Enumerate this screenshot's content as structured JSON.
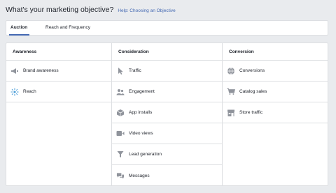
{
  "header": {
    "title": "What's your marketing objective?",
    "help_link": "Help: Choosing an Objective"
  },
  "tabs": [
    {
      "label": "Auction",
      "active": true
    },
    {
      "label": "Reach and Frequency",
      "active": false
    }
  ],
  "colors": {
    "accent": "#4267b2",
    "icon": "#90949c",
    "border": "#dddfe2",
    "background": "#e9ebee"
  },
  "columns": [
    {
      "title": "Awareness",
      "items": [
        {
          "label": "Brand awareness",
          "icon": "megaphone-icon"
        },
        {
          "label": "Reach",
          "icon": "reach-icon"
        }
      ]
    },
    {
      "title": "Consideration",
      "items": [
        {
          "label": "Traffic",
          "icon": "cursor-icon"
        },
        {
          "label": "Engagement",
          "icon": "people-icon"
        },
        {
          "label": "App installs",
          "icon": "cube-icon"
        },
        {
          "label": "Video views",
          "icon": "video-camera-icon"
        },
        {
          "label": "Lead generation",
          "icon": "funnel-icon"
        },
        {
          "label": "Messages",
          "icon": "chat-bubbles-icon"
        }
      ]
    },
    {
      "title": "Conversion",
      "items": [
        {
          "label": "Conversions",
          "icon": "globe-icon"
        },
        {
          "label": "Catalog sales",
          "icon": "shopping-cart-icon"
        },
        {
          "label": "Store traffic",
          "icon": "store-icon"
        }
      ]
    }
  ]
}
